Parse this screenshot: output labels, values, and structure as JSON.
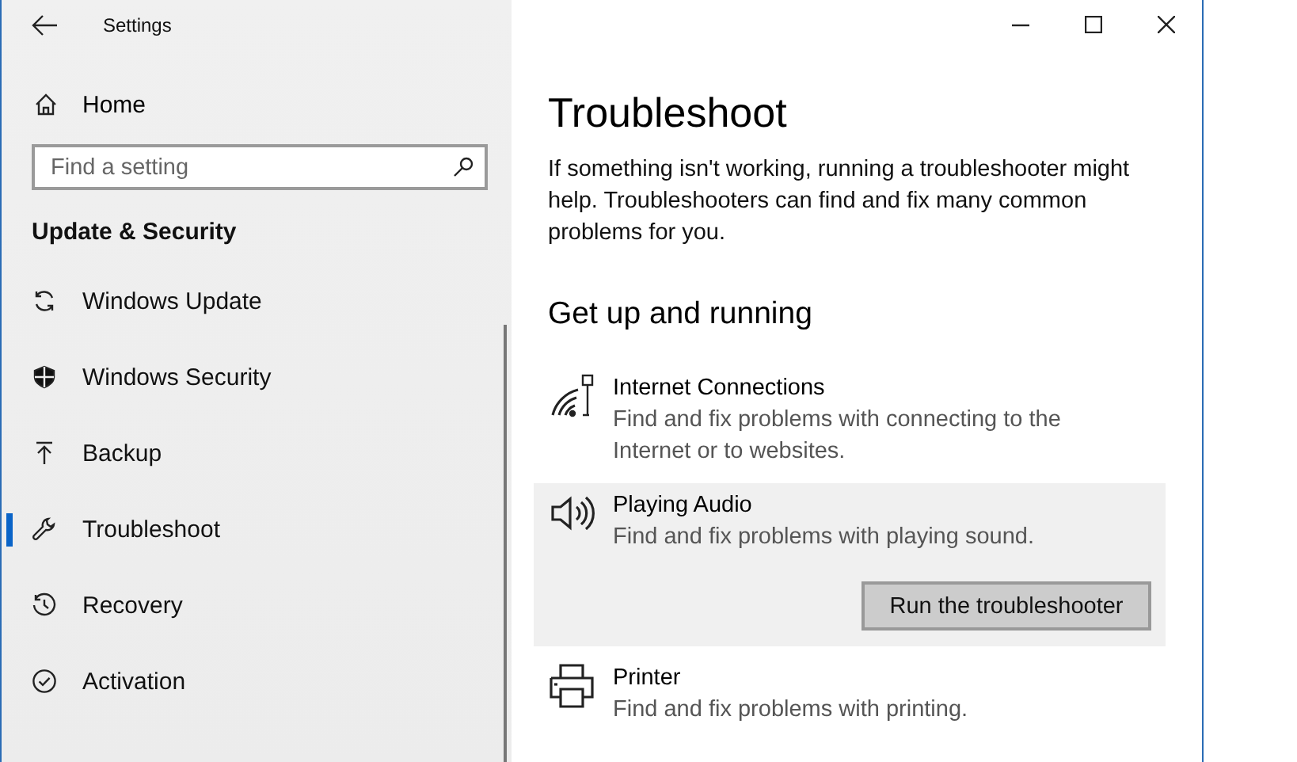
{
  "window": {
    "title": "Settings"
  },
  "sidebar": {
    "home": "Home",
    "search": {
      "placeholder": "Find a setting"
    },
    "section": "Update & Security",
    "items": [
      {
        "label": "Windows Update",
        "selected": false
      },
      {
        "label": "Windows Security",
        "selected": false
      },
      {
        "label": "Backup",
        "selected": false
      },
      {
        "label": "Troubleshoot",
        "selected": true
      },
      {
        "label": "Recovery",
        "selected": false
      },
      {
        "label": "Activation",
        "selected": false
      }
    ]
  },
  "main": {
    "title": "Troubleshoot",
    "description": "If something isn't working, running a troubleshooter might help. Troubleshooters can find and fix many common problems for you.",
    "section": "Get up and running",
    "troubleshooters": [
      {
        "title": "Internet Connections",
        "description": "Find and fix problems with connecting to the Internet or to websites.",
        "expanded": false
      },
      {
        "title": "Playing Audio",
        "description": "Find and fix problems with playing sound.",
        "expanded": true,
        "button": "Run the troubleshooter"
      },
      {
        "title": "Printer",
        "description": "Find and fix problems with printing.",
        "expanded": false
      }
    ]
  }
}
